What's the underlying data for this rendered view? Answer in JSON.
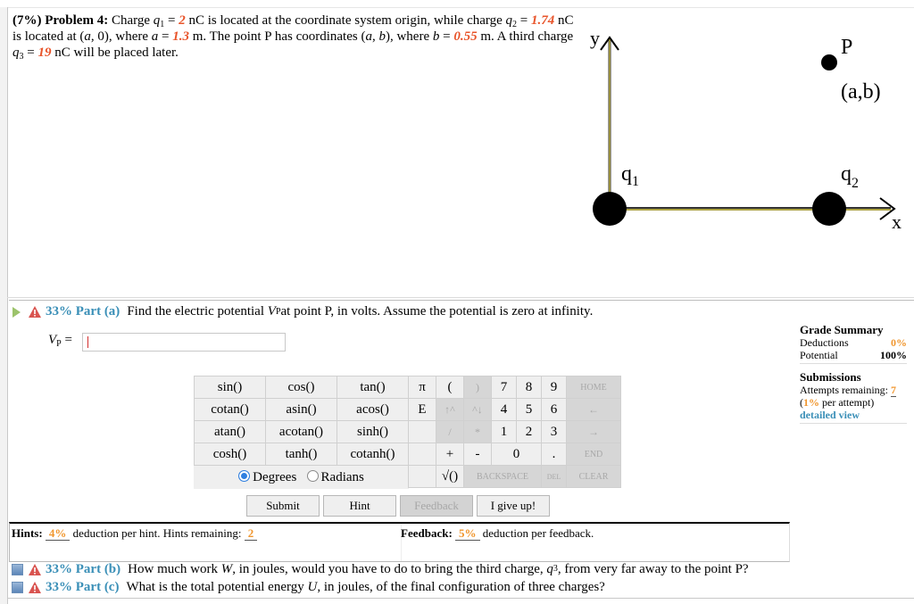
{
  "problem": {
    "weight": "(7%)",
    "title": "Problem 4:",
    "t1": "Charge ",
    "q1": "q",
    "q1_sub": "1",
    "eq": " = ",
    "q1_val": "2",
    "t2": " nC is located at the coordinate system origin, while charge ",
    "q2": "q",
    "q2_sub": "2",
    "q2_val": "1.74",
    "t3": " nC is located at (",
    "a": "a",
    "t4": ", 0), where ",
    "a_val": "1.3",
    "t5": " m. The point P has coordinates (",
    "b": "b",
    "t6": "), where ",
    "b_val": "0.55",
    "t7": " m. A third charge ",
    "q3": "q",
    "q3_sub": "3",
    "q3_val": "19",
    "t8": " nC will be placed later."
  },
  "diagram": {
    "y_label": "y",
    "x_label": "x",
    "p_label": "P",
    "p_coords": "(a,b)",
    "q1_label": "q",
    "q1_sub": "1",
    "q2_label": "q",
    "q2_sub": "2"
  },
  "part_a": {
    "percent": "33%",
    "label": "Part (a)",
    "question_1": "Find the electric potential ",
    "var": "V",
    "var_sub": "P",
    "question_2": " at point P, in volts. Assume the potential is zero at infinity.",
    "answer_label": "V",
    "answer_sub": "P",
    "answer_eq": " = ",
    "answer_value": ""
  },
  "calculator": {
    "functions": [
      [
        "sin()",
        "cos()",
        "tan()"
      ],
      [
        "cotan()",
        "asin()",
        "acos()"
      ],
      [
        "atan()",
        "acotan()",
        "sinh()"
      ],
      [
        "cosh()",
        "tanh()",
        "cotanh()"
      ]
    ],
    "angle_modes": [
      "Degrees",
      "Radians"
    ],
    "selected_mode": "Degrees",
    "keys": {
      "pi": "π",
      "lparen": "(",
      "rparen": ")",
      "n7": "7",
      "n8": "8",
      "n9": "9",
      "home": "HOME",
      "e": "E",
      "up": "↑^",
      "down": "^↓",
      "n4": "4",
      "n5": "5",
      "n6": "6",
      "left": "←",
      "div": "/",
      "mul": "*",
      "n1": "1",
      "n2": "2",
      "n3": "3",
      "right": "→",
      "plus": "+",
      "minus": "-",
      "n0": "0",
      "dot": ".",
      "end": "END",
      "sqrt": "√()",
      "backspace": "BACKSPACE",
      "del": "DEL",
      "clear": "CLEAR"
    }
  },
  "buttons": {
    "submit": "Submit",
    "hint": "Hint",
    "feedback": "Feedback",
    "give_up": "I give up!"
  },
  "hints": {
    "label": "Hints:",
    "deduction": "4%",
    "text": " deduction per hint. Hints remaining: ",
    "remaining": "2"
  },
  "feedback": {
    "label": "Feedback:",
    "deduction": "5%",
    "text": " deduction per feedback."
  },
  "grade_summary": {
    "title": "Grade Summary",
    "deductions_label": "Deductions",
    "deductions_value": "0%",
    "potential_label": "Potential",
    "potential_value": "100%",
    "submissions_title": "Submissions",
    "attempts_label": "Attempts remaining: ",
    "attempts_value": "7",
    "per_attempt_pct": "1%",
    "per_attempt_text": " per attempt)",
    "detailed_view": "detailed view"
  },
  "part_b": {
    "percent": "33%",
    "label": "Part (b)",
    "q1": "How much work ",
    "var": "W",
    "q2": ", in joules, would you have to do to bring the third charge, ",
    "q": "q",
    "q_sub": "3",
    "q3": ", from very far away to the point P?"
  },
  "part_c": {
    "percent": "33%",
    "label": "Part (c)",
    "q1": "What is the total potential energy ",
    "var": "U",
    "q2": ", in joules, of the final configuration of three charges?"
  },
  "colors": {
    "accent_blue": "#3a8fb7",
    "value_red": "#e8542a",
    "orange": "#f0962e"
  }
}
